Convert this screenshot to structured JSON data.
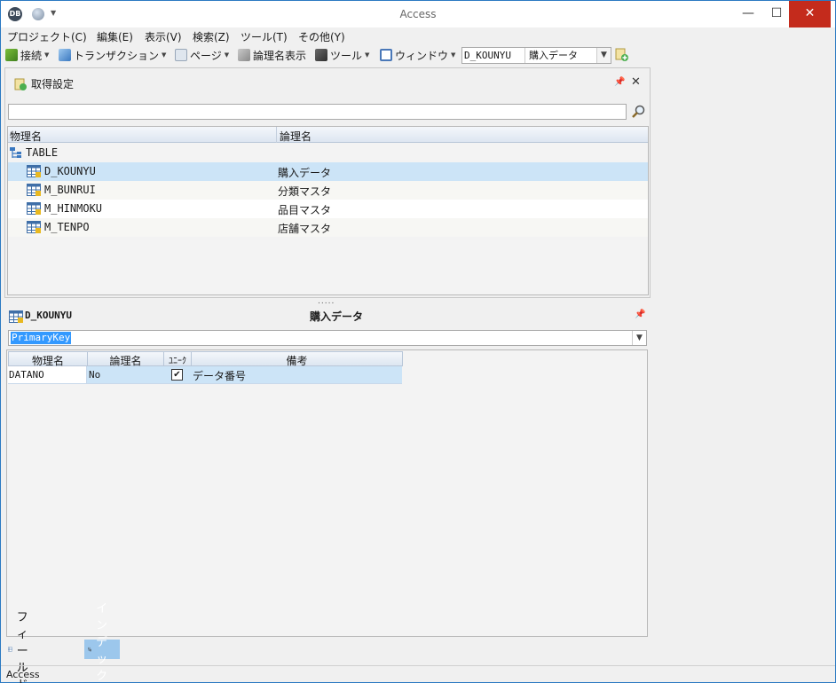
{
  "window": {
    "title": "Access"
  },
  "menubar": [
    "プロジェクト(C)",
    "編集(E)",
    "表示(V)",
    "検索(Z)",
    "ツール(T)",
    "その他(Y)"
  ],
  "toolbar": {
    "connect": "接続",
    "transaction": "トランザクション",
    "page": "ページ",
    "logical_name_display": "論理名表示",
    "tools": "ツール",
    "window": "ウィンドウ",
    "table_combo": {
      "physical": "D_KOUNYU",
      "logical": "購入データ"
    }
  },
  "top_panel": {
    "title": "取得設定",
    "search_value": "",
    "columns": [
      "物理名",
      "論理名"
    ],
    "group": "TABLE",
    "rows": [
      {
        "physical": "D_KOUNYU",
        "logical": "購入データ",
        "selected": true
      },
      {
        "physical": "M_BUNRUI",
        "logical": "分類マスタ",
        "selected": false
      },
      {
        "physical": "M_HINMOKU",
        "logical": "品目マスタ",
        "selected": false
      },
      {
        "physical": "M_TENPO",
        "logical": "店舗マスタ",
        "selected": false
      }
    ]
  },
  "splitter": ".....",
  "bottom_panel": {
    "table_physical": "D_KOUNYU",
    "table_logical": "購入データ",
    "index_selected": "PrimaryKey",
    "columns": [
      "物理名",
      "論理名",
      "ﾕﾆｰｸ",
      "備考"
    ],
    "rows": [
      {
        "physical": "DATANO",
        "logical": "No",
        "unique": true,
        "note": "データ番号"
      }
    ]
  },
  "tabs": [
    {
      "label": "フィールド",
      "active": false
    },
    {
      "label": "インデックス",
      "active": true
    }
  ],
  "statusbar": {
    "text": "Access"
  },
  "colors": {
    "accent": "#3399ff",
    "selection": "#cce4f7",
    "tab_active": "#9cc7ec",
    "close": "#c42b1c"
  }
}
